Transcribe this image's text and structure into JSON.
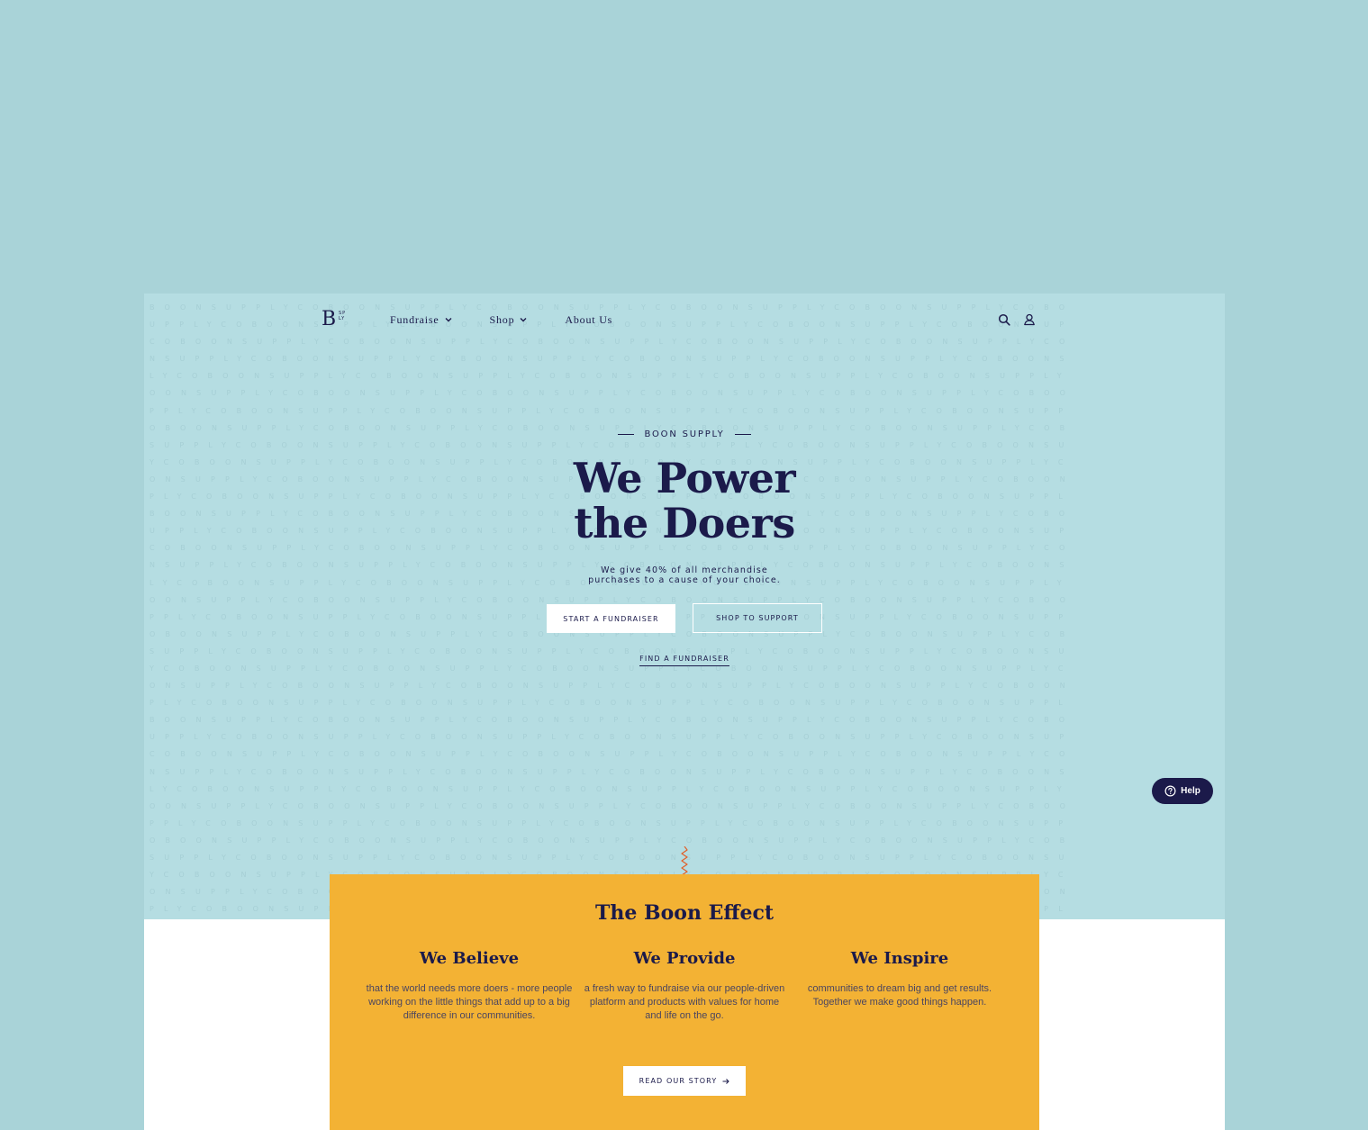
{
  "logo": {
    "letter": "B",
    "mini_line1": "SP",
    "mini_line2": "LY"
  },
  "nav": {
    "items": [
      {
        "label": "Fundraise",
        "has_dropdown": true
      },
      {
        "label": "Shop",
        "has_dropdown": true
      },
      {
        "label": "About Us",
        "has_dropdown": false
      }
    ]
  },
  "header_icons": [
    "search-icon",
    "user-icon"
  ],
  "hero": {
    "eyebrow": "BOON SUPPLY",
    "headline_line1": "We Power",
    "headline_line2": "the Doers",
    "subtext_line1": "We give 40% of all merchandise",
    "subtext_line2": "purchases to a cause of your choice.",
    "primary_button": "START A FUNDRAISER",
    "secondary_button": "SHOP TO SUPPORT",
    "link": "FIND A FUNDRAISER",
    "pattern_text": "BOONSUPPLYCO"
  },
  "help": {
    "label": "Help"
  },
  "effect": {
    "title": "The Boon Effect",
    "columns": [
      {
        "heading": "We Believe",
        "body": "that the world needs more doers - more people working on the little things that add up to a big difference in our communities."
      },
      {
        "heading": "We Provide",
        "body": "a fresh way to fundraise via our people-driven platform and products with values for home and life on the go."
      },
      {
        "heading": "We Inspire",
        "body": "communities to dream big and get results. Together we make good things happen."
      }
    ],
    "button": "READ OUR STORY"
  },
  "colors": {
    "outer_background": "#a9d3d8",
    "hero_background": "#b5dde2",
    "navy": "#1b1a4a",
    "mustard": "#f3b234",
    "accent_orange": "#e0602a"
  }
}
